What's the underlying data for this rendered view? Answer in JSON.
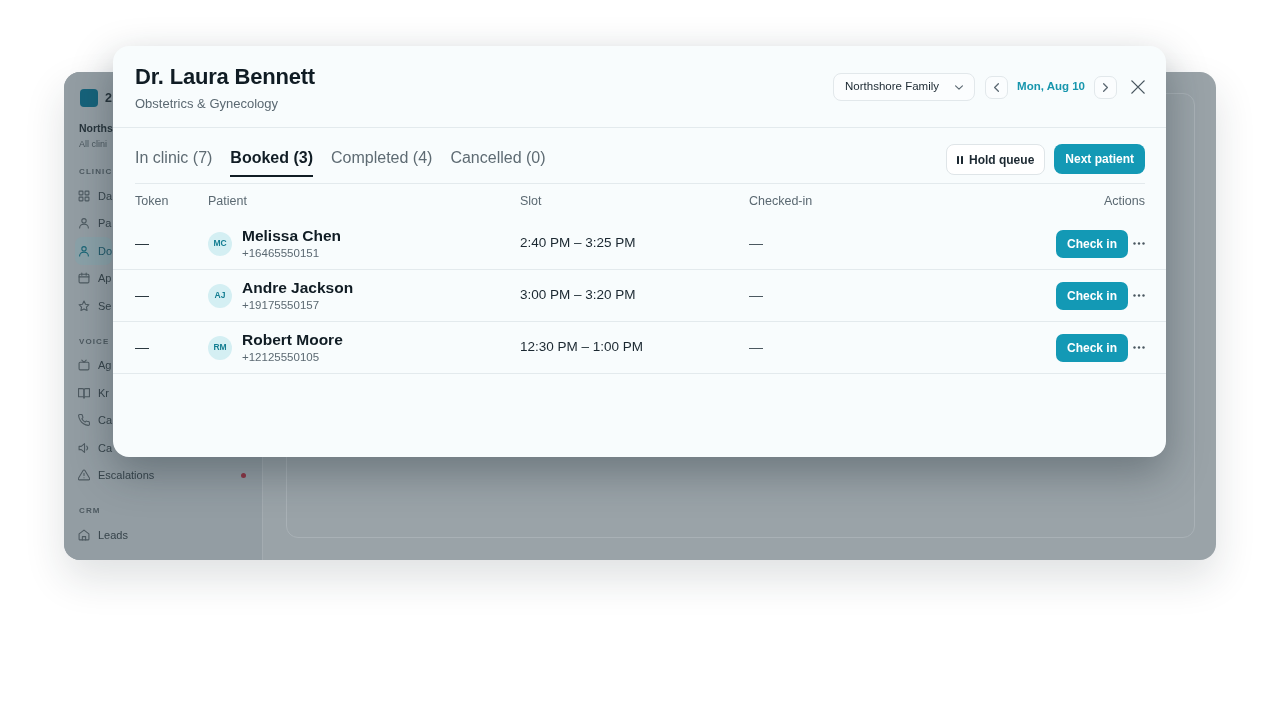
{
  "app": {
    "logo_text": "2",
    "workspace": {
      "name": "Norths",
      "subtitle": "All clini"
    },
    "sidebar": [
      {
        "label": "CLINIC",
        "items": [
          {
            "label": "Da",
            "selected": false,
            "alert": false
          },
          {
            "label": "Pa",
            "selected": false,
            "alert": false
          },
          {
            "label": "Do",
            "selected": true,
            "alert": false
          },
          {
            "label": "Ap",
            "selected": false,
            "alert": false
          },
          {
            "label": "Se",
            "selected": false,
            "alert": false
          }
        ]
      },
      {
        "label": "VOICE",
        "items": [
          {
            "label": "Ag",
            "selected": false,
            "alert": false
          },
          {
            "label": "Kr",
            "selected": false,
            "alert": false
          },
          {
            "label": "Ca",
            "selected": false,
            "alert": false
          },
          {
            "label": "Ca",
            "selected": false,
            "alert": false
          },
          {
            "label": "Escalations",
            "selected": false,
            "alert": true
          }
        ]
      },
      {
        "label": "CRM",
        "items": [
          {
            "label": "Leads",
            "selected": false,
            "alert": false
          }
        ]
      }
    ]
  },
  "dialog": {
    "title": "Dr. Laura Bennett",
    "subtitle": "Obstetrics & Gynecology",
    "location": "Northshore Family",
    "date": "Mon, Aug 10",
    "tabs": [
      {
        "label": "In clinic (7)",
        "selected": false
      },
      {
        "label": "Booked (3)",
        "selected": true
      },
      {
        "label": "Completed (4)",
        "selected": false
      },
      {
        "label": "Cancelled (0)",
        "selected": false
      }
    ],
    "buttons": [
      {
        "kind": "secondary",
        "label": "Hold queue"
      },
      {
        "kind": "primary",
        "label": "Next patient"
      }
    ],
    "table": {
      "columns": [
        "Token",
        "Patient",
        "Slot",
        "Checked-in",
        "Actions"
      ],
      "rows": [
        {
          "token": "—",
          "initials": "MC",
          "name": "Melissa Chen",
          "phone": "+16465550151",
          "slot": "2:40 PM – 3:25 PM",
          "checked_in": "—",
          "action": "Check in"
        },
        {
          "token": "—",
          "initials": "AJ",
          "name": "Andre Jackson",
          "phone": "+19175550157",
          "slot": "3:00 PM – 3:20 PM",
          "checked_in": "—",
          "action": "Check in"
        },
        {
          "token": "—",
          "initials": "RM",
          "name": "Robert Moore",
          "phone": "+12125550105",
          "slot": "12:30 PM – 1:00 PM",
          "checked_in": "—",
          "action": "Check in"
        }
      ]
    }
  }
}
